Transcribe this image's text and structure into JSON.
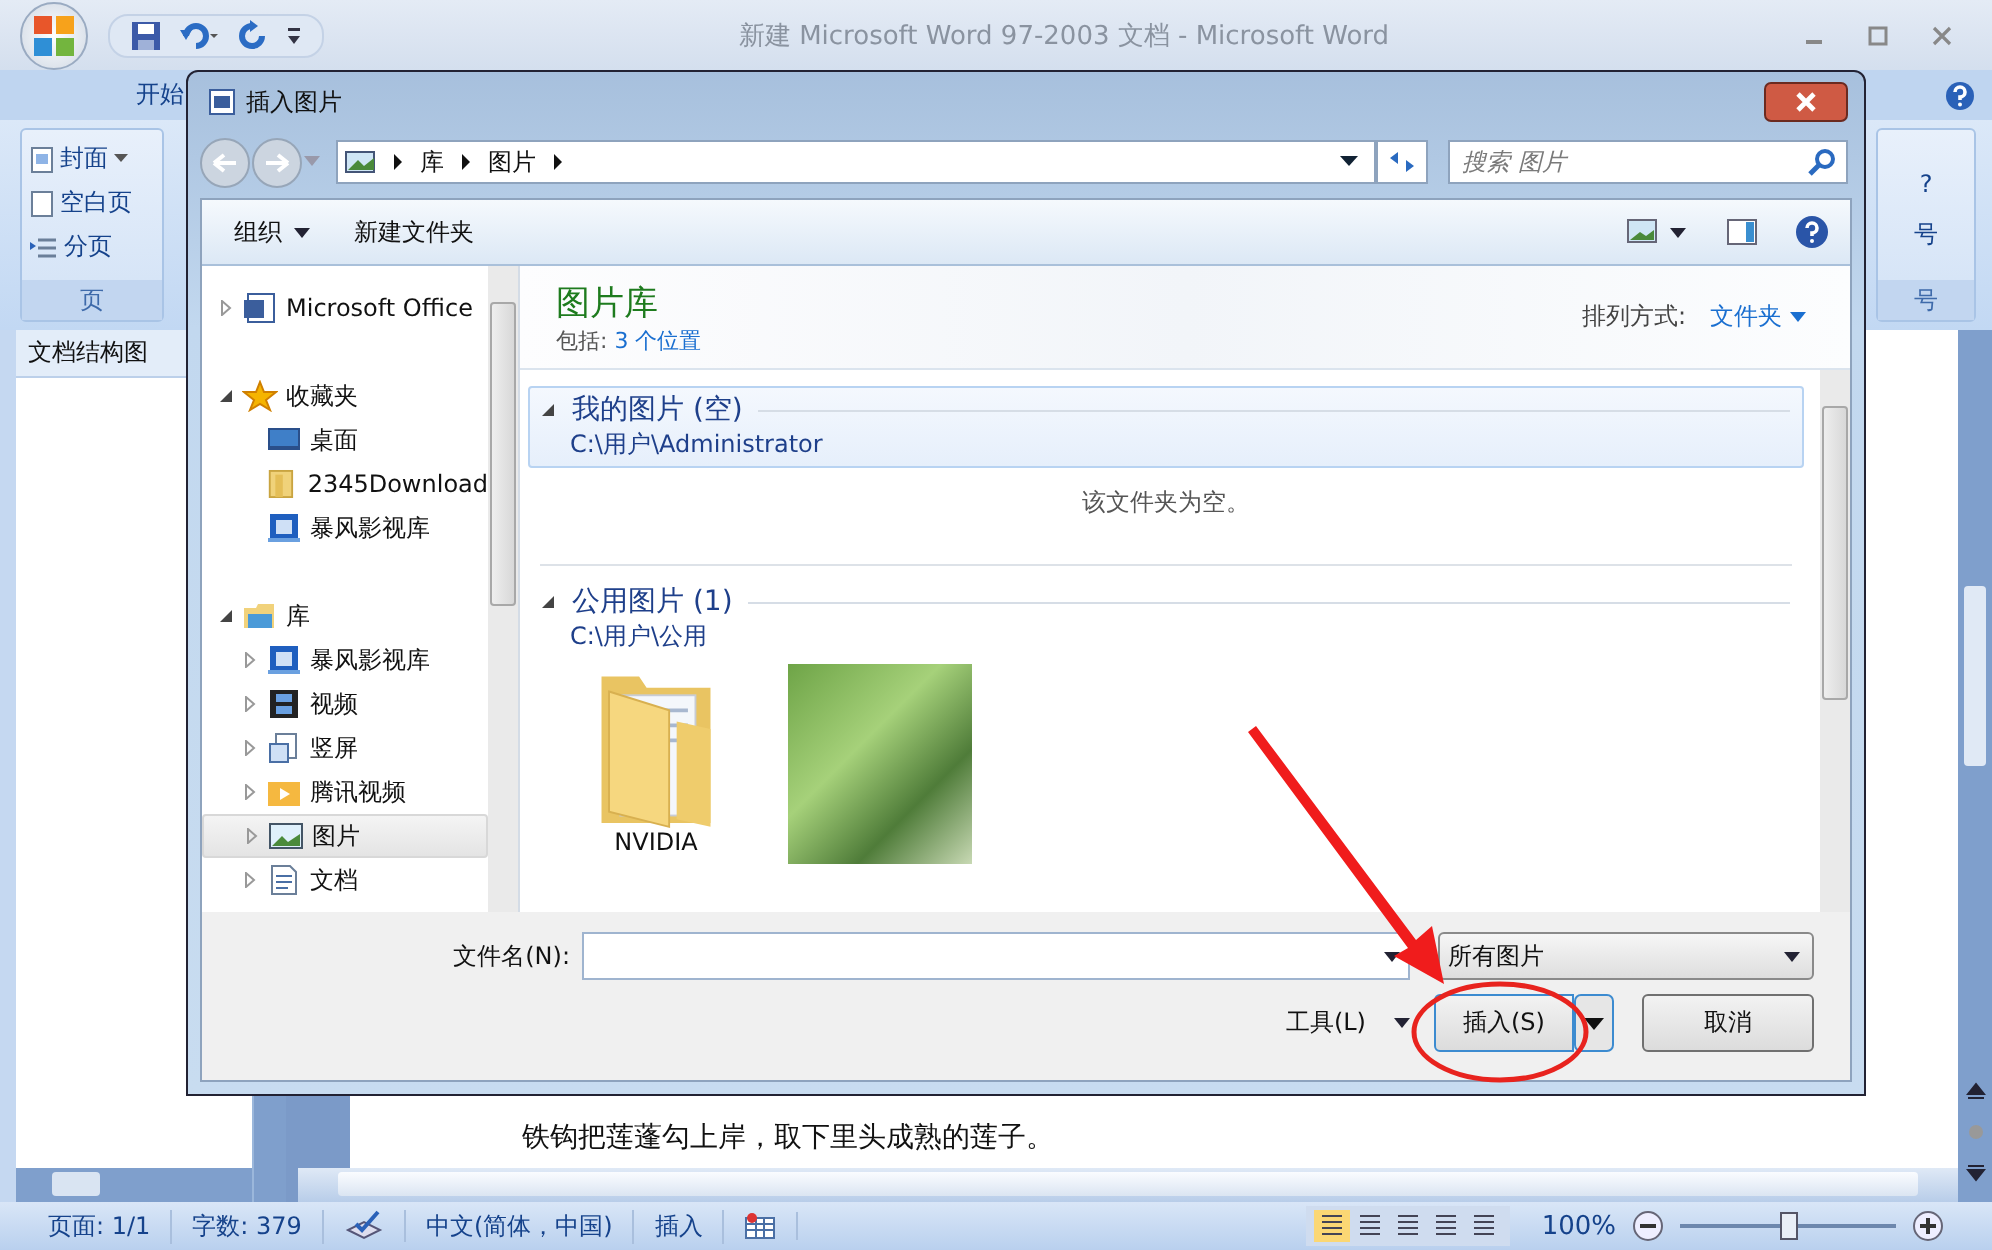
{
  "window": {
    "title": "新建 Microsoft Word 97-2003 文档 - Microsoft Word"
  },
  "ribbon": {
    "tabs": [
      {
        "label": "开始",
        "selected": false
      }
    ],
    "page_group": {
      "items": [
        {
          "kind": "cover",
          "label": "封面",
          "dropdown": true
        },
        {
          "kind": "blank",
          "label": "空白页",
          "dropdown": false
        },
        {
          "kind": "break",
          "label": "分页",
          "dropdown": false
        }
      ],
      "label": "页"
    },
    "symbol_group": {
      "items": [
        {
          "label": "?"
        },
        {
          "label": "号"
        }
      ],
      "label": "号"
    }
  },
  "navigation_pane": {
    "title": "文档结构图"
  },
  "document": {
    "text": "铁钩把莲蓬勾上岸，取下里头成熟的莲子。"
  },
  "status_bar": {
    "page": "页面: 1/1",
    "words": "字数: 379",
    "language": "中文(简体，中国)",
    "mode": "插入",
    "zoom": "100%",
    "zoom_slider": {
      "level": 0.5
    }
  },
  "dialog": {
    "title": "插入图片",
    "breadcrumbs": [
      "库",
      "图片"
    ],
    "search": {
      "placeholder": "搜索 图片"
    },
    "toolbar": [
      "组织",
      "新建文件夹"
    ],
    "tree": [
      {
        "kind": "word",
        "label": "Microsoft Office",
        "expanded": false,
        "selected": false
      },
      {
        "kind": "star",
        "label": "收藏夹",
        "expanded": true,
        "selected": false,
        "children": [
          {
            "kind": "desktop",
            "label": "桌面",
            "selected": false
          },
          {
            "kind": "folder",
            "label": "2345Download",
            "selected": false
          },
          {
            "kind": "media",
            "label": "暴风影视库",
            "selected": false
          }
        ]
      },
      {
        "kind": "library",
        "label": "库",
        "expanded": true,
        "selected": false,
        "children": [
          {
            "kind": "media",
            "label": "暴风影视库",
            "expanded": false,
            "selected": false
          },
          {
            "kind": "film",
            "label": "视频",
            "expanded": false,
            "selected": false
          },
          {
            "kind": "screen",
            "label": "竖屏",
            "expanded": false,
            "selected": false
          },
          {
            "kind": "tencent",
            "label": "腾讯视频",
            "expanded": false,
            "selected": false
          },
          {
            "kind": "picture",
            "label": "图片",
            "expanded": false,
            "selected": true
          },
          {
            "kind": "document",
            "label": "文档",
            "expanded": false,
            "selected": false
          }
        ]
      }
    ],
    "library": {
      "title": "图片库",
      "includes_label": "包括:",
      "includes_link": "3 个位置",
      "arrange_label": "排列方式:",
      "arrange_value": "文件夹"
    },
    "groups": [
      {
        "title": "我的图片 (空)",
        "path": "C:\\用户\\Administrator",
        "selected": true,
        "empty_text": "该文件夹为空。"
      },
      {
        "title": "公用图片 (1)",
        "path": "C:\\用户\\公用",
        "selected": false,
        "items": [
          {
            "kind": "folder",
            "label": "NVIDIA"
          },
          {
            "kind": "photo"
          }
        ]
      }
    ],
    "filename_label": "文件名(N):",
    "filter": "所有图片",
    "tools": "工具(L)",
    "insert": "插入(S)",
    "cancel": "取消"
  }
}
